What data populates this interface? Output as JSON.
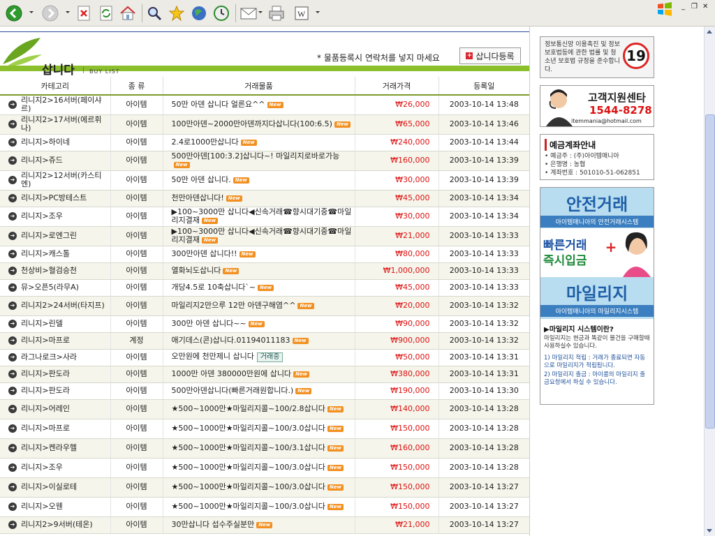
{
  "browser": {
    "toolbar": [
      "back-icon",
      "forward-icon",
      "stop-icon",
      "refresh-icon",
      "home-icon",
      "search-icon",
      "favorites-icon",
      "media-icon",
      "history-icon",
      "mail-icon",
      "print-icon",
      "edit-icon"
    ],
    "window_controls": [
      "_",
      "❐",
      "✕"
    ]
  },
  "header": {
    "title": "삽니다",
    "separator": "|",
    "subtitle": "BUY LIST",
    "notice": "* 물품등록시 연락처를 넣지 마세요",
    "register_button": "삽니다등록",
    "register_icon": "+"
  },
  "table": {
    "headers": [
      "카테고리",
      "종 류",
      "거래물품",
      "거래가격",
      "등록일"
    ],
    "badge_text": "New",
    "trading_text": "거래중",
    "rows": [
      {
        "cat": "리니지2>16서버(페이샤르)",
        "type": "아이템",
        "item": "50만 아덴 삽니다 얼른요^^",
        "badge": true,
        "price": "₩26,000",
        "date": "2003-10-14 13:48"
      },
      {
        "cat": "리니지2>17서버(에르휘나)",
        "type": "아이템",
        "item": "100만아덴~2000만아덴까지다삽니다(100:6.5)",
        "badge": true,
        "price": "₩65,000",
        "date": "2003-10-14 13:46"
      },
      {
        "cat": "리니지>하이네",
        "type": "아이템",
        "item": "2.4로1000만삽니다",
        "badge": true,
        "price": "₩240,000",
        "date": "2003-10-14 13:44"
      },
      {
        "cat": "리니지>쥬드",
        "type": "아이템",
        "item": "500만아덴[100:3.2]삽니다~! 마일리지로바로가능",
        "badge": true,
        "price": "₩160,000",
        "date": "2003-10-14 13:39"
      },
      {
        "cat": "리니지2>12서버(카스티엔)",
        "type": "아이템",
        "item": "50만 아덴 삽니다.",
        "badge": true,
        "price": "₩30,000",
        "date": "2003-10-14 13:39"
      },
      {
        "cat": "리니지>PC방테스트",
        "type": "아이템",
        "item": "천만아덴삽니다!",
        "badge": true,
        "price": "₩45,000",
        "date": "2003-10-14 13:34"
      },
      {
        "cat": "리니지>조우",
        "type": "아이템",
        "item": "▶100~3000만 삽니다◀신속거래☎향시대기중☎마일리지결재",
        "badge": true,
        "price": "₩30,000",
        "date": "2003-10-14 13:34"
      },
      {
        "cat": "리니지>로엔그린",
        "type": "아이템",
        "item": "▶100~3000만 삽니다◀신속거래☎향시대기중☎마일리지결재",
        "badge": true,
        "price": "₩21,000",
        "date": "2003-10-14 13:33"
      },
      {
        "cat": "리니지>캐스톨",
        "type": "아이템",
        "item": "300만아덴 삽니다!!",
        "badge": true,
        "price": "₩80,000",
        "date": "2003-10-14 13:33"
      },
      {
        "cat": "천상비>혈검승천",
        "type": "아이템",
        "item": "열화뇌도삽니다",
        "badge": true,
        "price": "₩1,000,000",
        "date": "2003-10-14 13:33"
      },
      {
        "cat": "뮤>오픈5(라무A)",
        "type": "아이템",
        "item": "개당4.5로 10축삽니다`~",
        "badge": true,
        "price": "₩45,000",
        "date": "2003-10-14 13:33"
      },
      {
        "cat": "리니지2>24서버(타지프)",
        "type": "아이템",
        "item": "마일리지2만으루 12만 아덴구해염^^",
        "badge": true,
        "price": "₩20,000",
        "date": "2003-10-14 13:32"
      },
      {
        "cat": "리니지>린델",
        "type": "아이템",
        "item": "300만 아덴 삽니다~~",
        "badge": true,
        "price": "₩90,000",
        "date": "2003-10-14 13:32"
      },
      {
        "cat": "리니지>마프로",
        "type": "계정",
        "item": "애기데스(콘)삽니다.01194011183",
        "badge": true,
        "price": "₩900,000",
        "date": "2003-10-14 13:32"
      },
      {
        "cat": "라그나로크>사라",
        "type": "아이템",
        "item": "오만원에 천만제니 삽니다",
        "trading": true,
        "price": "₩50,000",
        "date": "2003-10-14 13:31"
      },
      {
        "cat": "리니지>판도라",
        "type": "아이템",
        "item": "1000만 아덴 380000만원에 삽니다",
        "badge": true,
        "price": "₩380,000",
        "date": "2003-10-14 13:31"
      },
      {
        "cat": "리니지>판도라",
        "type": "아이템",
        "item": "500만아덴삽니다(빠른거래원합니다.)",
        "badge": true,
        "price": "₩190,000",
        "date": "2003-10-14 13:30"
      },
      {
        "cat": "리니지>어레인",
        "type": "아이템",
        "item": "★500~1000만★마일리지콜~100/2.8삽니다",
        "badge": true,
        "price": "₩140,000",
        "date": "2003-10-14 13:28"
      },
      {
        "cat": "리니지>마프로",
        "type": "아이템",
        "item": "★500~1000만★마일리지콜~100/3.0삽니다",
        "badge": true,
        "price": "₩150,000",
        "date": "2003-10-14 13:28"
      },
      {
        "cat": "리니지>켄라우헬",
        "type": "아이템",
        "item": "★500~1000만★마일리지콜~100/3.1삽니다",
        "badge": true,
        "price": "₩160,000",
        "date": "2003-10-14 13:28"
      },
      {
        "cat": "리니지>조우",
        "type": "아이템",
        "item": "★500~1000만★마일리지콜~100/3.0삽니다",
        "badge": true,
        "price": "₩150,000",
        "date": "2003-10-14 13:28"
      },
      {
        "cat": "리니지>이실로테",
        "type": "아이템",
        "item": "★500~1000만★마일리지콜~100/3.0삽니다",
        "badge": true,
        "price": "₩150,000",
        "date": "2003-10-14 13:27"
      },
      {
        "cat": "리니지>오웬",
        "type": "아이템",
        "item": "★500~1000만★마일리지콜~100/3.0삽니다",
        "badge": true,
        "price": "₩150,000",
        "date": "2003-10-14 13:27"
      },
      {
        "cat": "리니지2>9서버(테온)",
        "type": "아이템",
        "item": "30만삽니다 섭수주실분만",
        "badge": true,
        "price": "₩21,000",
        "date": "2003-10-14 13:27"
      }
    ]
  },
  "sidebar": {
    "notice_text": "정보통신망 이용촉진 및 정보 보호법등에 관한 법률 및 청소년 보호법 규정을 준수합니다.",
    "age_badge": "19",
    "support_title": "고객지원센타",
    "support_phone": "1544-8278",
    "support_email": "itemmania@hotmail.com",
    "account_title": "예금계좌안내",
    "account_lines": [
      "• 예금주 : (주)아이템매니아",
      "• 은행명 : 농협",
      "• 계좌번호 : 501010-51-062851"
    ],
    "safe_title": "안전거래",
    "safe_sub": "아이템매니아의 안전거래시스템",
    "fast_line1": "빠른거래",
    "fast_line2": "즉시입금",
    "fast_plus": "+",
    "mileage_title": "마일리지",
    "mileage_sub": "아이템매니아의 마일리지시스템",
    "mileage_q": "▶마일리지 시스템이란?",
    "mileage_desc": "마일리지는 현금과 똑같이 물건을 구매할때 사용하실수 있습니다.",
    "mileage_1": "1) 마일리지 적립 : 거래가 종료되면 자동으로 마일리지가 적립됩니다.",
    "mileage_2": "2) 마일리지 출금 : 마이룸의 마일리지 출금요청에서 하실 수 있습니다."
  },
  "colors": {
    "price": "#dd1111",
    "accent_green": "#8cbf2c",
    "badge": "#f29021",
    "banner_blue": "#3b7fc0"
  }
}
